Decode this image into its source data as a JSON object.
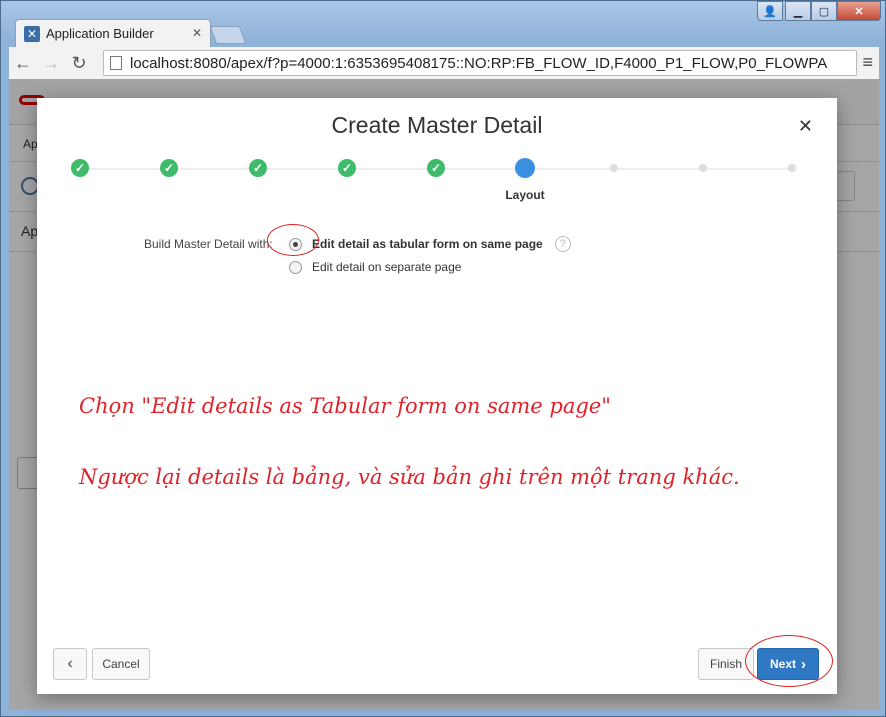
{
  "browser": {
    "tab_title": "Application Builder",
    "url": "localhost:8080/apex/f?p=4000:1:6353695408175::NO:RP:FB_FLOW_ID,F4000_P1_FLOW,P0_FLOWPA"
  },
  "background": {
    "crumb": "Ap",
    "section": "Ap"
  },
  "modal": {
    "title": "Create Master Detail",
    "current_step_label": "Layout",
    "form_label": "Build Master Detail with:",
    "options": [
      {
        "label": "Edit detail as tabular form on same page",
        "checked": true
      },
      {
        "label": "Edit detail on separate page",
        "checked": false
      }
    ],
    "buttons": {
      "cancel": "Cancel",
      "finish": "Finish",
      "next": "Next"
    }
  },
  "annotations": {
    "note1": "Chọn \"Edit details as Tabular form on same page\"",
    "note2": "Ngược lại details là bảng, và sửa bản ghi trên một trang khác."
  },
  "colors": {
    "step_done": "#3fbc6b",
    "step_current": "#3a8fe0",
    "next_button": "#2f78c4",
    "annotation": "#e0222a"
  }
}
